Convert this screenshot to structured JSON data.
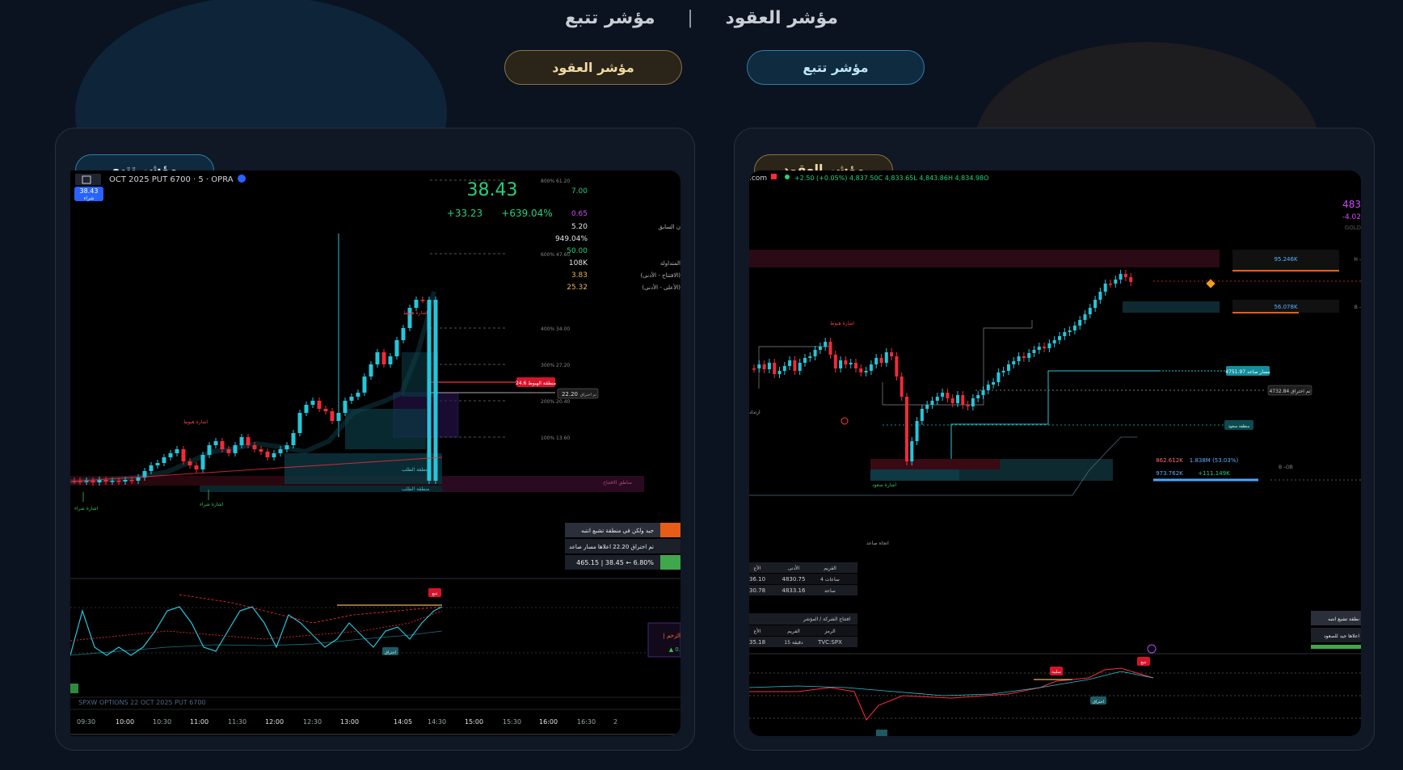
{
  "header": {
    "title_right": "مؤشر العقود",
    "separator": "|",
    "title_left": "مؤشر تتبع"
  },
  "toggle": {
    "gold_label": "مؤشر العقود",
    "blue_label": "مؤشر تتبع"
  },
  "colors": {
    "accent_gold": "#e6b45c",
    "accent_blue": "#29b6d0",
    "up": "#26c6da",
    "down": "#ef2b3c",
    "background": "#0b1220"
  },
  "left_card": {
    "tab_label": "مؤشر تتبع",
    "symbol": "OCT 2025 PUT 6700 · 5 · OPRA",
    "price_badge": "38.43",
    "badge_sub": "شراء",
    "stats": {
      "last": "38.43",
      "change": "+33.23",
      "change_pct": "+639.04%",
      "r1": "7.00",
      "r2": "0.65",
      "r3": "5.20",
      "r4": "949.04%",
      "r5": "50.00",
      "r6": "108K",
      "r7": "3.83",
      "r8": "25.32",
      "lbl_prev": "ن السابق",
      "lbl_volume": "المتداولة",
      "lbl_open_low": "(الافتتاح - الأدنى)",
      "lbl_high_low": "(الأعلى - الأدنى)"
    },
    "fib_levels": [
      "800%  61.20",
      "600%  47.60",
      "400%  34.00",
      "300%  27.20",
      "200%  20.40",
      "100%  13.60"
    ],
    "labels": {
      "red_zone": "منطقة الهبوط 24.6",
      "break_level": "22.20",
      "break_text": "تم اختراق",
      "demand_zone": "منطقة الطلب",
      "supply_zone": "منطقة الطلب",
      "open_level": "مناطق الافتتاح",
      "sell_signal_1": "اشارة هبوط",
      "sell_signal_2": "اشارة هبوط",
      "buy_signal_1": "اشارة شراء",
      "buy_signal_2": "اشارة شراء",
      "osc_top": "تتبع",
      "osc_break": "اختراق",
      "momentum": "| الزخم",
      "momentum_val": "▲ 0."
    },
    "alerts": [
      "جيد ولكن في منطقة تشبع انتبه",
      "تم اختراق 22.20 اعلاها مسار صاعد",
      "465.15 | 38.45 ← 6.80%"
    ],
    "footer_symbol": "SPXW OPTIONS 22 OCT 2025 PUT 6700",
    "times": [
      "09:30",
      "10:00",
      "10:30",
      "11:00",
      "11:30",
      "12:00",
      "12:30",
      "13:00",
      "14:05",
      "14:30",
      "15:00",
      "15:30",
      "16:00",
      "16:30",
      "2"
    ]
  },
  "right_card": {
    "tab_label": "مؤشر العقود",
    "ohlc": "+2.50 (+0.05%) 4,837.50C 4,833.65L 4,843.86H 4,834.98O",
    "domain": ".com",
    "side_price": "483",
    "side_change": "-4.02",
    "side_tag": "GOLD",
    "vol_top": "95.246K",
    "vol_mid": "56.078K",
    "level_h": "H -",
    "level_b": "B -",
    "level_up": "مسار صاعد 4751.97",
    "level_break": "تم اختراق 4732.84",
    "level_zone": "منطقة سعود",
    "bid1": "862.612K",
    "bid2": "1.838M (53.03%)",
    "ask1": "973.762K",
    "ask2": "+111.149K",
    "ob_label": "B –OB",
    "sell_signal": "اشارة هبوط",
    "buy_signal": "اشارة صعود",
    "up_trend": "اتجاه صاعد",
    "dir_label": "ارتداد",
    "table1": {
      "headers": [
        "القريم",
        "الأدنى",
        "الأع"
      ],
      "rows": [
        [
          "4 ساعات",
          "4830.75",
          "36.10"
        ],
        [
          "ساعة",
          "4833.16",
          "30.78"
        ]
      ]
    },
    "table2": {
      "title": "افتتاح الشركة / المؤشر",
      "headers": [
        "الرمز",
        "الفريم",
        "الأع"
      ],
      "rows": [
        [
          "TVC:SPX",
          "15 دقيقة",
          "35.18"
        ]
      ]
    },
    "alerts": [
      "نطقة تشبع انتبه",
      "اعلاها جيد للصعود"
    ],
    "osc_sell": "سلبية",
    "osc_top": "تتبع",
    "osc_break": "اختراق"
  }
}
